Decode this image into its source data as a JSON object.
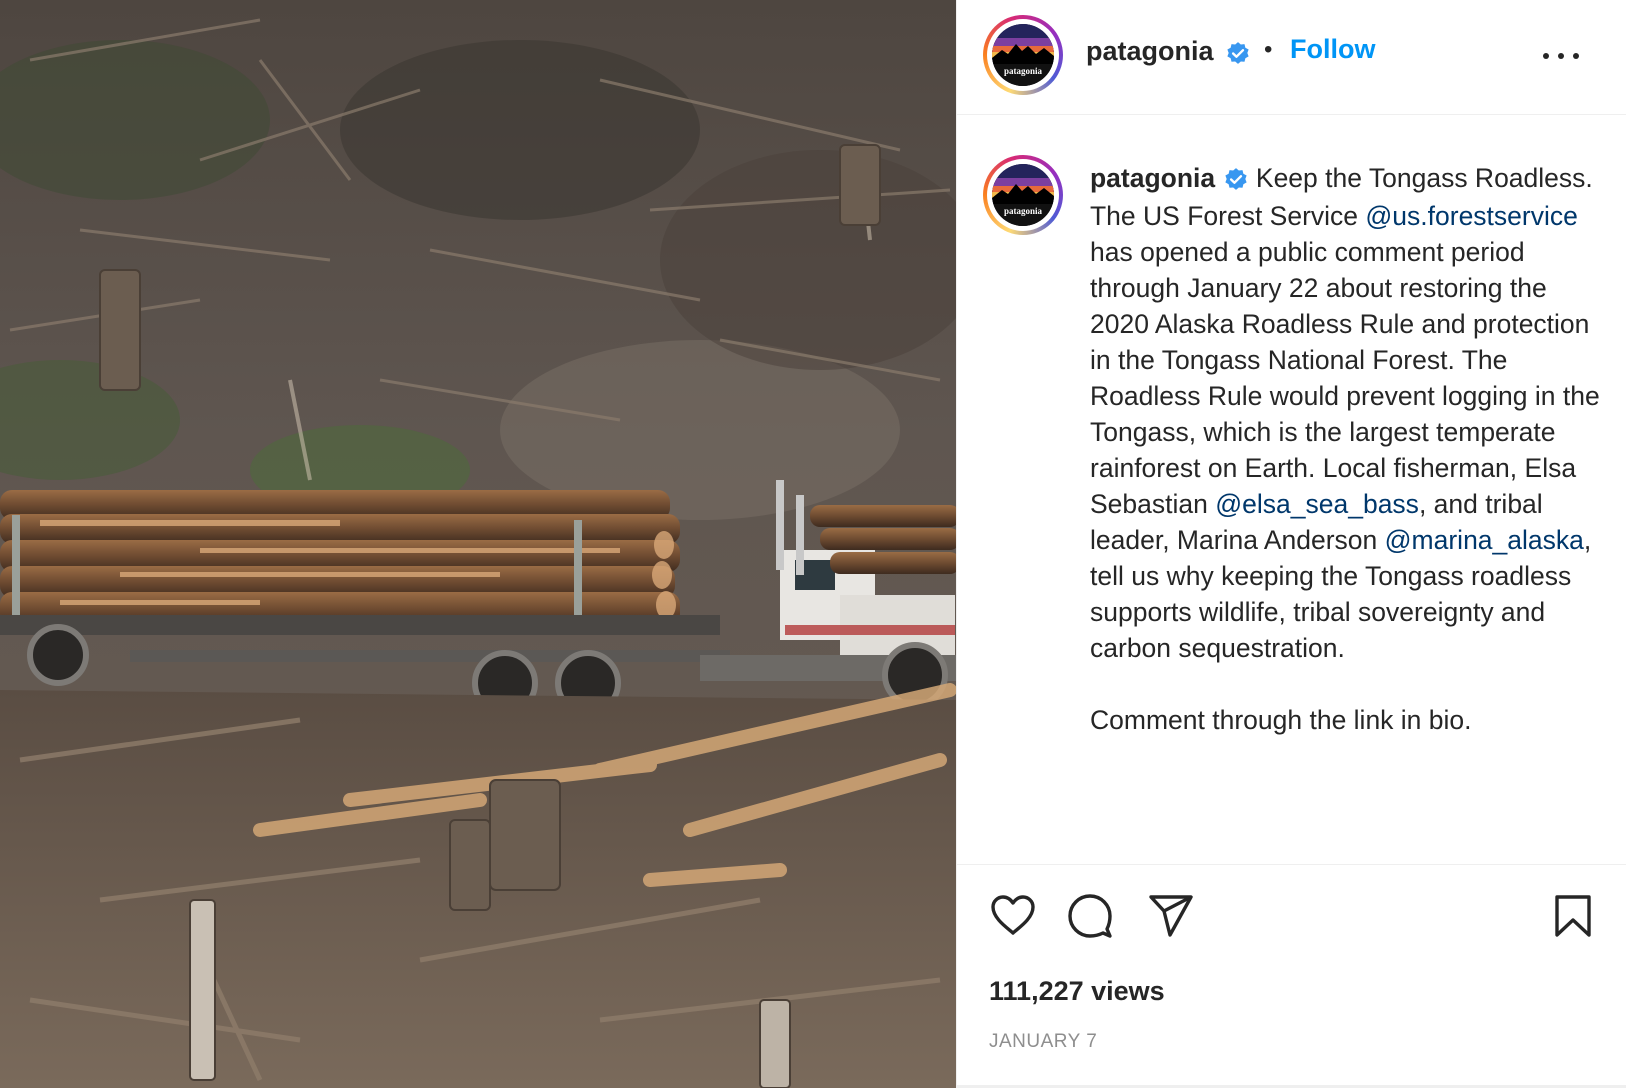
{
  "post": {
    "image_alt": "Logging truck loaded with timber on a clear-cut hillside",
    "account": {
      "username": "patagonia",
      "logo_text": "patagonia",
      "verified": true,
      "follow_label": "Follow"
    },
    "caption": {
      "username": "patagonia",
      "t1": " Keep the Tongass Roadless. The US Forest Service ",
      "m1": "@us.forestservice",
      "t2": " has opened a public comment period through January 22 about restoring the 2020 Alaska Roadless Rule and protection in the Tongass National Forest. The Roadless Rule would prevent logging in the Tongass, which is the largest temperate rainforest on Earth. Local fisherman, Elsa Sebastian ",
      "m2": "@elsa_sea_bass",
      "t3": ", and tribal leader, Marina Anderson ",
      "m3": "@marina_alaska",
      "t4": ", tell us why keeping the Tongass roadless supports wildlife, tribal sovereignty and carbon sequestration.",
      "p2": "Comment through the link in bio."
    },
    "views": "111,227 views",
    "date": "JANUARY 7"
  },
  "icons": [
    "heart-icon",
    "comment-icon",
    "share-icon",
    "bookmark-icon",
    "more-icon",
    "verified-icon"
  ],
  "colors": {
    "follow": "#0095f6",
    "mention": "#00376b",
    "verified": "#3897f0",
    "muted": "#8e8e8e"
  }
}
